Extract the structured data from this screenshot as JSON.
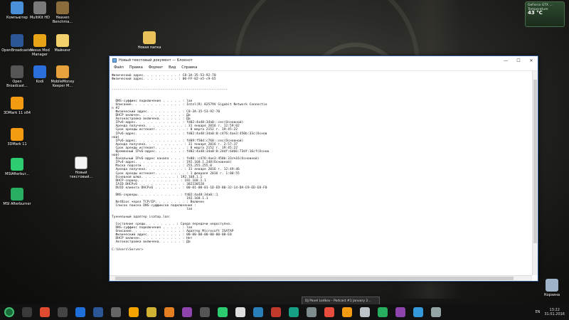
{
  "desktop": {
    "icons_left": [
      {
        "label": "Компьютер",
        "color": "#4a90d9"
      },
      {
        "label": "MultiKit HD",
        "color": "#7a7a7a"
      },
      {
        "label": "Heaven Benchma...",
        "color": "#8a6d3b"
      },
      {
        "label": "OpenBroadcaster",
        "color": "#2b5797"
      },
      {
        "label": "Nexus Mod Manager",
        "color": "#e8a317"
      },
      {
        "label": "Майнинг",
        "color": "#f2d06b"
      },
      {
        "label": "Open Broadcast...",
        "color": "#555"
      },
      {
        "label": "Kodi",
        "color": "#2a6fdb"
      },
      {
        "label": "MobileMoney Keeper M...",
        "color": "#e6a23c"
      },
      {
        "label": "3DMark 11 x64",
        "color": "#f39c12"
      },
      {
        "label": "3DMark 11",
        "color": "#f39c12"
      },
      {
        "label": "MSIAfterbur...",
        "color": "#2ecc71"
      },
      {
        "label": "MSI Afterburner",
        "color": "#27ae60"
      }
    ],
    "folder_label": "Новая папка",
    "file_label": "Новый текстовый...",
    "recycle_label": "Корзина"
  },
  "window": {
    "title": "Новый текстовый документ — Блокнот",
    "menu": [
      "Файл",
      "Правка",
      "Формат",
      "Вид",
      "Справка"
    ],
    "content": "Физический адрес. . . . . . . . . : C8-3A-35-53-92-70\nФизический адрес. . . . . . . . . : 00-FF-02-e5-c9-65\n\n\n-----------------------------------------------------------\n\n\n  DNS-суффикс подключения . . . . . : lan\n  Описание. . . . . . . . . . . . . : Intel(R) 82579V Gigabit Network Connectio\nn #2\n  Физический адрес. . . . . . . . . : C8-3A-35-53-92-70\n  DHCP включен. . . . . . . . . . . : Да\n  Автонастройка включена. . . . . . : Да\n  IPv6-адрес. . . . . . . . . . . . : fd02:4a48:34a0::cec(Основной)\n  Аренда получена. . . . . . . . . . : 31 января 2016 г. 12:59:02\n  Срок аренды истекает. . . . . . . . : 8 марта 2152 г. 19:45:22\n  IPv6-адрес. . . . . . . . . . . . : fd02:4a48:34a0:0:c476:4ae3:450b:33c(Основ\nной)\n  IPv6-адрес. . . . . . . . . . . . : fd09:f50d:c768::cec(Основной)\n  Аренда получена. . . . . . . . . . : 31 января 2016 г. 2:57:37\n  Срок аренды истекает. . . . . . . . : 8 марта 2152 г. 19:45:22\n  Временный IPv6-адрес. . . . . . . : fd02:4a48:34a0:0:24df:6d66:73df:16cf(Основ\nной)\n  Локальный IPv6-адрес канала . . . : fe80::c476:4ae3:450b:33c%16(Основной)\n  IPv4-адрес. . . . . . . . . . . . : 192.168.1.248(Основной)\n  Маска подсети . . . . . . . . . . : 255.255.255.0\n  Аренда получена. . . . . . . . . . : 31 января 2016 г. 12:49:46\n  Срок аренды истекает. . . . . . . . : 1 февраля 2016 г. 1:00:55\n  Основной шлюз. . . . . . . . . : 192.168.1.1\n  DHCP-сервер. . . . . . . . . . . : 192.168.1.1\n  IAID DHCPv6 . . . . . . . . . . . : 382230528\n  DUID клиента DHCPv6 . . . . . . . : 00-01-00-01-1D-ED-80-32-14-DA-E9-ED-E8-F0\n\n  DNS-серверы. . . . . . . . . . . : fd02:4a48:34a0::1\n                                      192.168.1.1\n  NetBios через TCP/IP. . . . . . . . : Включен\n  Список поиска DNS-суффиксов подключения :\n                                      lan\n\nТуннельный адаптер isatap.lan:\n\n  Состояние среды. . . . . . . . : Среда передачи недоступна.\n  DNS-суффикс подключения . . . . . : lan\n  Описание. . . . . . . . . . . . . : Адаптер Microsoft ISATAP\n  Физический адрес. . . . . . . . . : 00-00-00-00-00-00-00-E0\n  DHCP включен. . . . . . . . . . . : Нет\n  Автонастройка включена. . . . . . : Да\n\nC:\\Users\\Server>"
  },
  "taskbar": {
    "icon_colors": [
      "#3a3a3a",
      "#e04a2f",
      "#444",
      "#1e6fd9",
      "#2b5797",
      "#666",
      "#f4a300",
      "#d2b232",
      "#e67e22",
      "#8e44ad",
      "#555",
      "#2ecc71",
      "#ddd",
      "#2980b9",
      "#c0392b",
      "#16a085",
      "#7f8c8d",
      "#e74c3c",
      "#f39c12",
      "#bdc3c7",
      "#27ae60",
      "#8e44ad",
      "#3498db",
      "#95a5a6"
    ],
    "popup_text": "DJ Pavel Lodkov - Podcast #1 January 2...",
    "lang": "EN",
    "time": "13:22",
    "date": "31.01.2016"
  },
  "gadget": {
    "title": "GeForce GTX ...",
    "label": "Temperature",
    "value": "43 °C"
  }
}
